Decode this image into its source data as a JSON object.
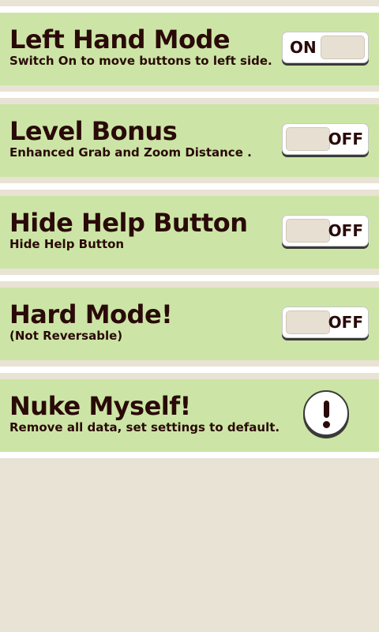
{
  "settings": [
    {
      "title": "Left Hand Mode",
      "subtitle": "Switch On to move buttons to left side.",
      "state": "ON"
    },
    {
      "title": "Level Bonus",
      "subtitle": "Enhanced Grab and Zoom Distance .",
      "state": "OFF"
    },
    {
      "title": "Hide Help Button",
      "subtitle": "Hide Help Button",
      "state": "OFF"
    },
    {
      "title": "Hard Mode!",
      "subtitle": "(Not Reversable)",
      "state": "OFF"
    }
  ],
  "nuke": {
    "title": "Nuke Myself!",
    "subtitle": "Remove all data, set settings to default.",
    "icon": "exclamation-icon"
  },
  "colors": {
    "panel": "#cce5a6",
    "background": "#e9e3d5",
    "text": "#2a0a08",
    "stripe": "#ffffff"
  }
}
